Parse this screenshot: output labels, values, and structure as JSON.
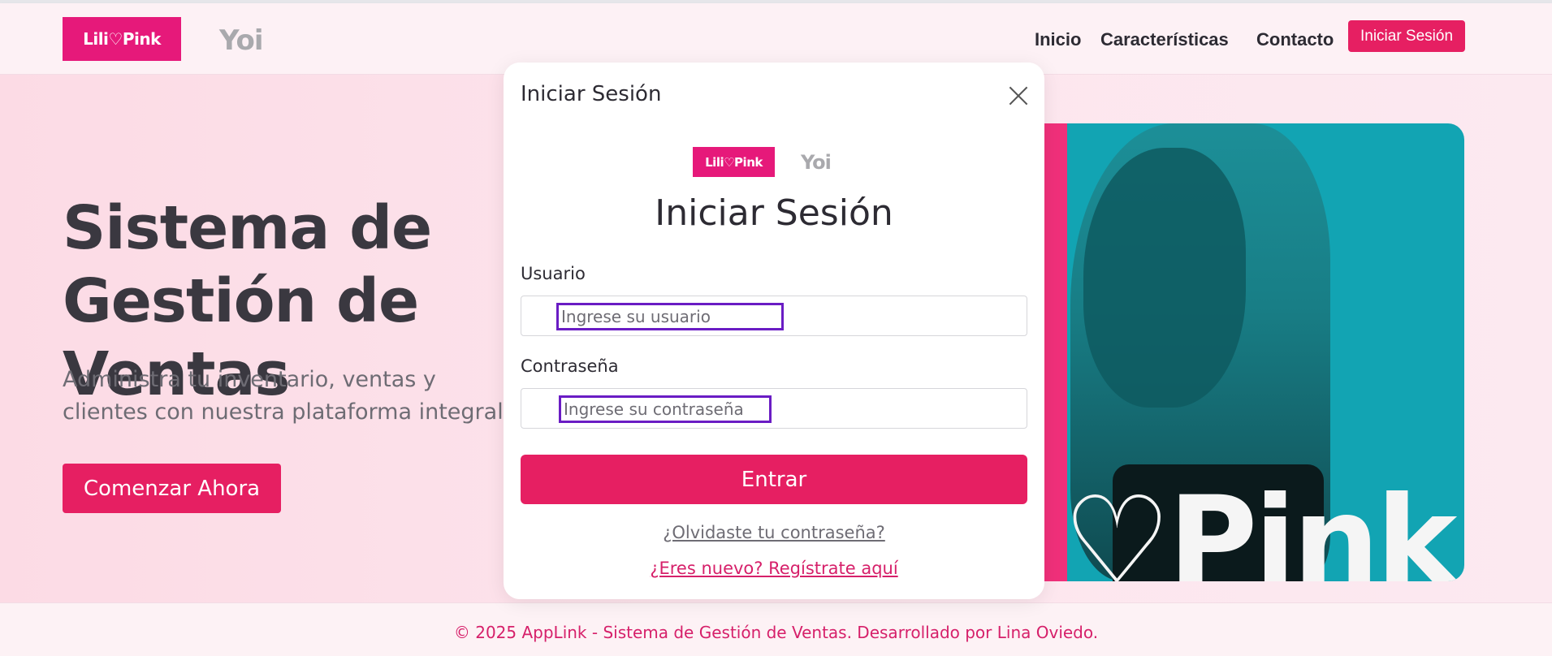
{
  "header": {
    "brand_logo": "Lili♡Pink",
    "partner_logo": "Yoi",
    "nav": [
      "Inicio",
      "Características",
      "Contacto"
    ],
    "login_button": "Iniciar Sesión"
  },
  "hero": {
    "title": "Sistema de Gestión de Ventas",
    "subtitle": "Administra tu inventario, ventas y clientes con nuestra plataforma integral.",
    "cta": "Comenzar Ahora",
    "image_text": "♡Pink"
  },
  "modal": {
    "title": "Iniciar Sesión",
    "brand_logo": "Lili♡Pink",
    "partner_logo": "Yoi",
    "heading": "Iniciar Sesión",
    "username_label": "Usuario",
    "username_placeholder": "Ingrese su usuario",
    "password_label": "Contraseña",
    "password_placeholder": "Ingrese su contraseña",
    "submit": "Entrar",
    "forgot_link": "¿Olvidaste tu contraseña?",
    "register_link": "¿Eres nuevo? Regístrate aquí"
  },
  "footer": {
    "text": "© 2025 AppLink - Sistema de Gestión de Ventas. Desarrollado por Lina Oviedo."
  },
  "colors": {
    "brand_pink": "#e61f62",
    "logo_magenta": "#e6197a",
    "focus_outline": "#6a1cc4",
    "image_teal": "#12a4b3"
  }
}
